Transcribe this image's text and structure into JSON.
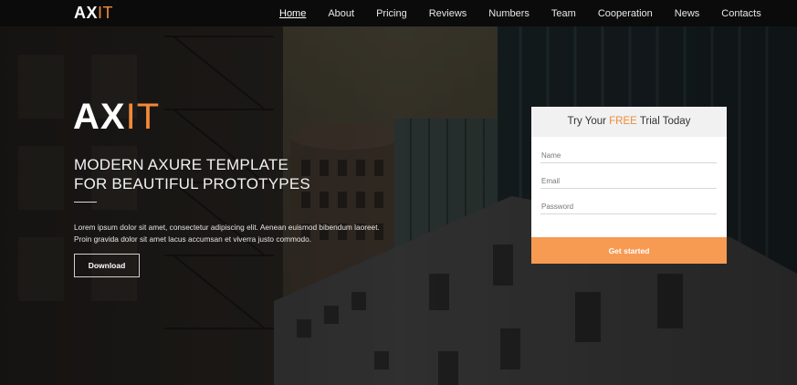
{
  "brand": {
    "main": "AX",
    "accent": "IT"
  },
  "nav": {
    "items": [
      {
        "label": "Home",
        "active": true
      },
      {
        "label": "About"
      },
      {
        "label": "Pricing"
      },
      {
        "label": "Reviews"
      },
      {
        "label": "Numbers"
      },
      {
        "label": "Team"
      },
      {
        "label": "Cooperation"
      },
      {
        "label": "News"
      },
      {
        "label": "Contacts"
      }
    ]
  },
  "hero": {
    "brand_main": "AX",
    "brand_accent": "IT",
    "title_line1": "MODERN AXURE TEMPLATE",
    "title_line2": "FOR BEAUTIFUL PROTOTYPES",
    "text_line1": "Lorem ipsum dolor sit amet, consectetur adipiscing elit. Aenean euismod bibendum laoreet.",
    "text_line2": "Proin gravida dolor sit amet lacus accumsan et viverra justo commodo.",
    "button": "Download"
  },
  "trial_card": {
    "title_before": "Try Your ",
    "title_highlight": "FREE",
    "title_after": " Trial Today",
    "name_placeholder": "Name",
    "email_placeholder": "Email",
    "password_placeholder": "Password",
    "submit": "Get started"
  },
  "colors": {
    "accent": "#f08a3a",
    "button": "#f79a52",
    "navbar": "#0b0b0b"
  },
  "icons": {
    "background": "city-buildings-photo"
  }
}
